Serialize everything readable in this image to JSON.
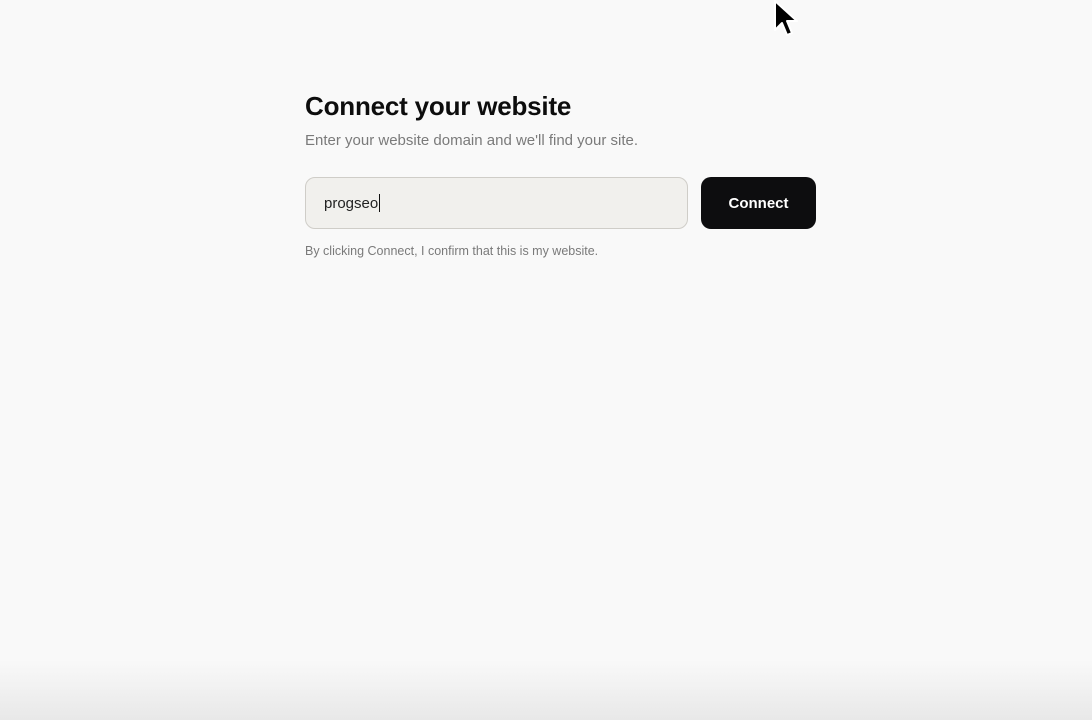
{
  "page": {
    "title": "Connect your website",
    "subtitle": "Enter your website domain and we'll find your site.",
    "domain_input": {
      "value": "progseo"
    },
    "connect_button_label": "Connect",
    "disclaimer": "By clicking Connect, I confirm that this is my website."
  },
  "colors": {
    "background": "#f9f9f9",
    "input_background": "#f1f0ed",
    "button_background": "#0d0d0f",
    "muted_text": "#7a7a7a"
  },
  "icons": {
    "cursor": "mouse-pointer-icon"
  }
}
